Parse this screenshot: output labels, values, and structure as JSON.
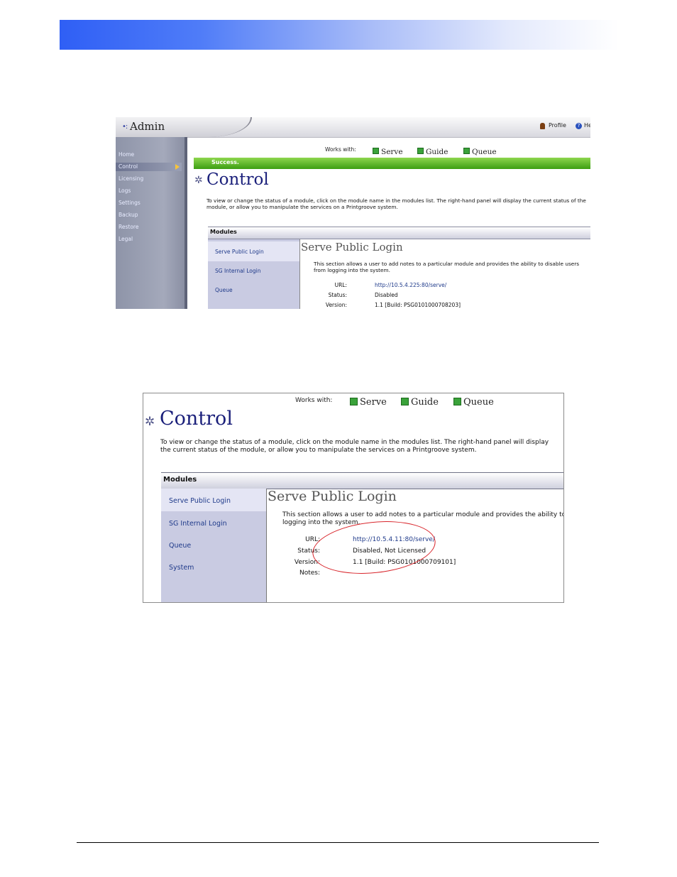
{
  "screenshot1": {
    "app_title": "Admin",
    "header_links": {
      "profile": "Profile",
      "help": "He"
    },
    "sidebar": [
      "Home",
      "Control",
      "Licensing",
      "Logs",
      "Settings",
      "Backup",
      "Restore",
      "Legal"
    ],
    "works_with": {
      "label": "Works with:",
      "items": [
        "Serve",
        "Guide",
        "Queue"
      ]
    },
    "success_message": "Success.",
    "page_title": "Control",
    "description": "To view or change the status of a module, click on the module name in the modules list. The right-hand panel will display the current status of the module, or allow you to manipulate the services on a Printgroove system.",
    "modules_header": "Modules",
    "modules": [
      "Serve Public Login",
      "SG Internal Login",
      "Queue"
    ],
    "panel": {
      "title": "Serve Public Login",
      "description": "This section allows a user to add notes to a particular module and provides the ability to disable users from logging into the system.",
      "fields": [
        {
          "label": "URL:",
          "value": "http://10.5.4.225:80/serve/"
        },
        {
          "label": "Status:",
          "value": "Disabled"
        },
        {
          "label": "Version:",
          "value": "1.1 [Build: PSG0101000708203]"
        }
      ]
    }
  },
  "screenshot2": {
    "works_with": {
      "label": "Works with:",
      "items": [
        "Serve",
        "Guide",
        "Queue"
      ]
    },
    "page_title": "Control",
    "description": "To view or change the status of a module, click on the module name in the modules list. The right-hand panel will display the current status of the module, or allow you to manipulate the services on a Printgroove system.",
    "modules_header": "Modules",
    "modules": [
      "Serve Public Login",
      "SG Internal Login",
      "Queue",
      "System"
    ],
    "panel": {
      "title": "Serve Public Login",
      "description_line1": "This section allows a user to add notes to a particular module and provides the ability to disable u",
      "description_line2": "logging into the system.",
      "fields": [
        {
          "label": "URL:",
          "value": "http://10.5.4.11:80/serve/"
        },
        {
          "label": "Status:",
          "value": "Disabled, Not Licensed"
        },
        {
          "label": "Version:",
          "value": "1.1 [Build: PSG0101000709101]"
        },
        {
          "label": "Notes:",
          "value": ""
        }
      ]
    }
  }
}
